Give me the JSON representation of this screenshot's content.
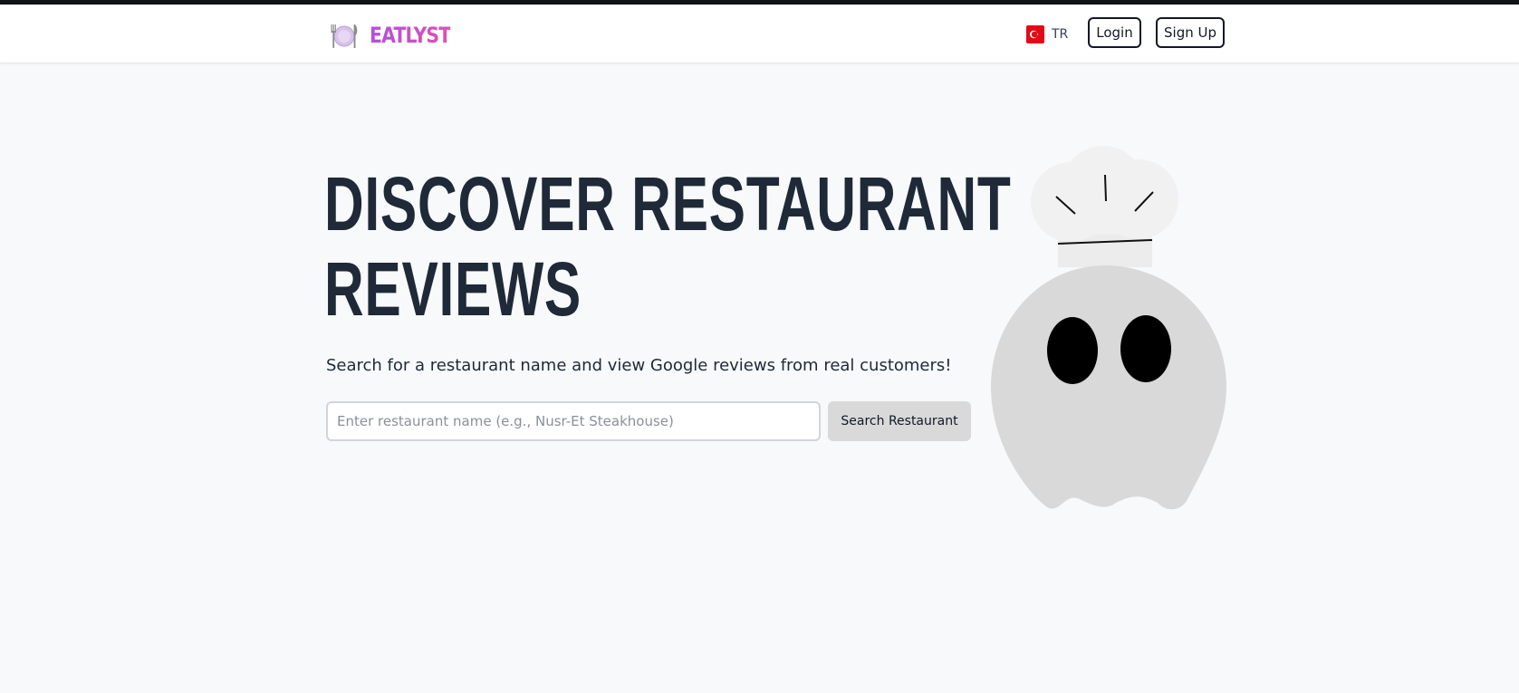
{
  "header": {
    "brand": "EATLYST",
    "language": {
      "code": "TR",
      "flag": "flag-turkey-icon"
    },
    "login_label": "Login",
    "signup_label": "Sign Up"
  },
  "hero": {
    "title_line1": "DISCOVER RESTAURANT",
    "title_line2": "REVIEWS",
    "subtitle": "Search for a restaurant name and view Google reviews from real customers!"
  },
  "search": {
    "placeholder": "Enter restaurant name (e.g., Nusr-Et Steakhouse)",
    "value": "",
    "button_label": "Search Restaurant"
  },
  "icons": {
    "logo": "plate-utensils-icon",
    "mascot": "chef-ghost-illustration"
  },
  "colors": {
    "background": "#f8f9fb",
    "brand_gradient_start": "#b14fe0",
    "brand_gradient_end": "#e04fb4",
    "title_text": "#1f2937",
    "search_button_bg": "#d9d9d9",
    "flag_red": "#e30a17"
  }
}
